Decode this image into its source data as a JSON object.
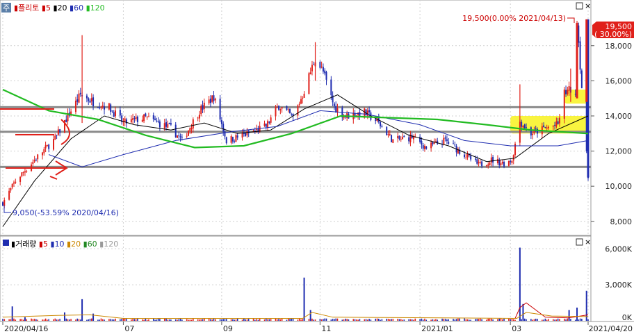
{
  "price_panel": {
    "corner_badge": "주",
    "legend": [
      {
        "label": "플리토",
        "color": "#cc0000"
      },
      {
        "label": "5",
        "color": "#cc0000"
      },
      {
        "label": "20",
        "color": "#000000"
      },
      {
        "label": "60",
        "color": "#1f2db0"
      },
      {
        "label": "120",
        "color": "#22bb22"
      }
    ],
    "current_price_label": "19,500",
    "current_change_label": "( 30.00%)",
    "high_annotation": "19,500(0.00% 2021/04/13)",
    "low_annotation": "9,050(-53.59% 2020/04/16)",
    "win_buttons": [
      "□",
      "×"
    ]
  },
  "volume_panel": {
    "legend": [
      {
        "label": "거래량",
        "color": "#000000"
      },
      {
        "label": "5",
        "color": "#cc0000"
      },
      {
        "label": "10",
        "color": "#1f2db0"
      },
      {
        "label": "20",
        "color": "#cc8800"
      },
      {
        "label": "60",
        "color": "#228822"
      },
      {
        "label": "120",
        "color": "#999999"
      }
    ],
    "win_buttons": [
      "□",
      "×"
    ]
  },
  "chart_data": {
    "type": "candlestick",
    "price_axis": {
      "ticks": [
        8000,
        10000,
        12000,
        14000,
        16000,
        18000
      ],
      "tick_labels": [
        "8,000",
        "10,000",
        "12,000",
        "14,000",
        "16,000",
        "18,000"
      ],
      "ylim": [
        7200,
        20600
      ]
    },
    "volume_axis": {
      "ticks": [
        0,
        3000,
        6000
      ],
      "tick_labels": [
        "0K",
        "3,000K",
        "6,000K"
      ],
      "ylim": [
        0,
        7000
      ],
      "unit": "K"
    },
    "x_tick_labels": [
      {
        "date": "2020-04-16",
        "label": "2020/04/16"
      },
      {
        "date": "2020-07-01",
        "label": "07"
      },
      {
        "date": "2020-09-01",
        "label": "09"
      },
      {
        "date": "2020-11-02",
        "label": "11"
      },
      {
        "date": "2021-01-04",
        "label": "2021/01"
      },
      {
        "date": "2021-03-02",
        "label": "03"
      },
      {
        "date": "2021-04-20",
        "label": "2021/04/20"
      }
    ],
    "date_range": [
      "2020-04-16",
      "2021-04-20"
    ],
    "horizontal_lines": [
      14500,
      13100,
      11100
    ],
    "highlight_bands": [
      {
        "from": "2021-03-02",
        "to": "2021-04-20",
        "low": 13000,
        "high": 14000
      },
      {
        "from": "2021-04-05",
        "to": "2021-04-20",
        "low": 14700,
        "high": 15500
      }
    ],
    "price_keypoints": [
      [
        "2020-04-16",
        9050
      ],
      [
        "2020-04-24",
        10300
      ],
      [
        "2020-05-06",
        11500
      ],
      [
        "2020-05-19",
        12700
      ],
      [
        "2020-05-29",
        14300
      ],
      [
        "2020-06-04",
        15200
      ],
      [
        "2020-06-12",
        14800
      ],
      [
        "2020-06-22",
        14500
      ],
      [
        "2020-07-01",
        13600
      ],
      [
        "2020-07-15",
        13900
      ],
      [
        "2020-07-31",
        13300
      ],
      [
        "2020-08-07",
        12600
      ],
      [
        "2020-08-18",
        14300
      ],
      [
        "2020-08-27",
        15100
      ],
      [
        "2020-09-04",
        12600
      ],
      [
        "2020-09-18",
        13000
      ],
      [
        "2020-09-29",
        13400
      ],
      [
        "2020-10-07",
        14600
      ],
      [
        "2020-10-16",
        13900
      ],
      [
        "2020-10-22",
        15200
      ],
      [
        "2020-10-30",
        17300
      ],
      [
        "2020-11-04",
        16500
      ],
      [
        "2020-11-11",
        14500
      ],
      [
        "2020-11-18",
        14000
      ],
      [
        "2020-11-30",
        14200
      ],
      [
        "2020-12-08",
        13700
      ],
      [
        "2020-12-18",
        12600
      ],
      [
        "2020-12-30",
        12800
      ],
      [
        "2021-01-08",
        12200
      ],
      [
        "2021-01-20",
        12600
      ],
      [
        "2021-02-01",
        11800
      ],
      [
        "2021-02-10",
        11200
      ],
      [
        "2021-02-18",
        11500
      ],
      [
        "2021-02-26",
        11300
      ],
      [
        "2021-03-03",
        11500
      ],
      [
        "2021-03-08",
        13700
      ],
      [
        "2021-03-15",
        13000
      ],
      [
        "2021-03-24",
        13300
      ],
      [
        "2021-04-01",
        13500
      ],
      [
        "2021-04-05",
        15300
      ],
      [
        "2021-04-09",
        15500
      ],
      [
        "2021-04-12",
        15000
      ],
      [
        "2021-04-13",
        19500
      ],
      [
        "2021-04-20",
        10500
      ]
    ],
    "ma_lines": [
      {
        "name": "5",
        "color": "#cc0000",
        "points": []
      },
      {
        "name": "20",
        "color": "#000000",
        "points": [
          [
            "2020-04-16",
            7700
          ],
          [
            "2020-05-06",
            10300
          ],
          [
            "2020-05-29",
            12700
          ],
          [
            "2020-06-19",
            14000
          ],
          [
            "2020-07-08",
            13500
          ],
          [
            "2020-07-31",
            13200
          ],
          [
            "2020-08-21",
            13600
          ],
          [
            "2020-09-11",
            13000
          ],
          [
            "2020-10-02",
            13200
          ],
          [
            "2020-10-23",
            14400
          ],
          [
            "2020-11-13",
            15200
          ],
          [
            "2020-12-04",
            14000
          ],
          [
            "2020-12-28",
            12900
          ],
          [
            "2021-01-22",
            12300
          ],
          [
            "2021-02-15",
            11400
          ],
          [
            "2021-03-05",
            11600
          ],
          [
            "2021-03-26",
            13000
          ],
          [
            "2021-04-20",
            14000
          ]
        ]
      },
      {
        "name": "60",
        "color": "#1f2db0",
        "points": [
          [
            "2020-05-15",
            11800
          ],
          [
            "2020-06-05",
            11100
          ],
          [
            "2020-07-01",
            11800
          ],
          [
            "2020-08-03",
            12600
          ],
          [
            "2020-09-07",
            13100
          ],
          [
            "2020-10-06",
            13400
          ],
          [
            "2020-11-02",
            14300
          ],
          [
            "2020-12-01",
            14100
          ],
          [
            "2021-01-04",
            13500
          ],
          [
            "2021-02-01",
            12600
          ],
          [
            "2021-03-02",
            12300
          ],
          [
            "2021-04-01",
            12300
          ],
          [
            "2021-04-20",
            12600
          ]
        ]
      },
      {
        "name": "120",
        "color": "#22bb22",
        "points": [
          [
            "2020-04-16",
            15500
          ],
          [
            "2020-05-15",
            14300
          ],
          [
            "2020-06-15",
            13800
          ],
          [
            "2020-07-15",
            12900
          ],
          [
            "2020-08-15",
            12200
          ],
          [
            "2020-09-15",
            12300
          ],
          [
            "2020-10-15",
            13000
          ],
          [
            "2020-11-15",
            14000
          ],
          [
            "2020-12-15",
            13900
          ],
          [
            "2021-01-15",
            13800
          ],
          [
            "2021-02-15",
            13500
          ],
          [
            "2021-03-15",
            13200
          ],
          [
            "2021-04-20",
            13000
          ]
        ]
      }
    ],
    "volume_spikes": [
      [
        "2020-04-22",
        1200
      ],
      [
        "2020-04-30",
        300
      ],
      [
        "2020-05-25",
        700
      ],
      [
        "2020-06-05",
        1800
      ],
      [
        "2020-06-12",
        600
      ],
      [
        "2020-10-23",
        3600
      ],
      [
        "2020-10-27",
        900
      ],
      [
        "2021-03-08",
        6100
      ],
      [
        "2021-03-10",
        1400
      ],
      [
        "2021-04-08",
        900
      ],
      [
        "2021-04-13",
        1100
      ],
      [
        "2021-04-19",
        2500
      ]
    ]
  }
}
